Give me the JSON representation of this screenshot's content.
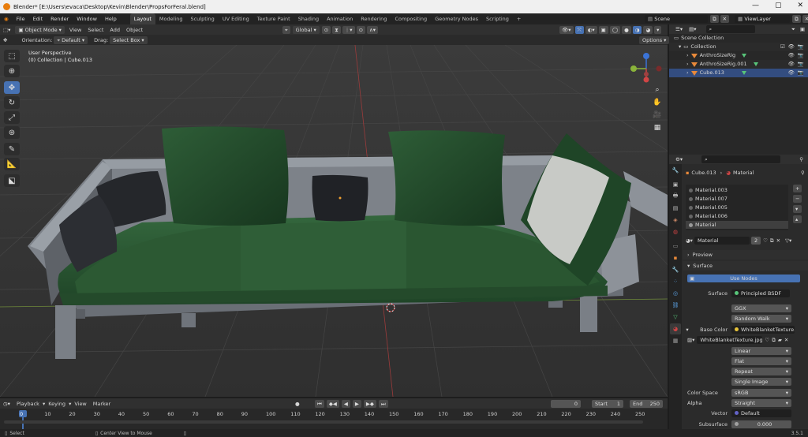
{
  "window": {
    "title": "Blender* [E:\\Users\\evaca\\Desktop\\Kevin\\Blender\\PropsForFeral.blend]",
    "buttons": [
      "—",
      "▢",
      "✕"
    ]
  },
  "menu": [
    "File",
    "Edit",
    "Render",
    "Window",
    "Help"
  ],
  "workspaces": [
    "Layout",
    "Modeling",
    "Sculpting",
    "UV Editing",
    "Texture Paint",
    "Shading",
    "Animation",
    "Rendering",
    "Compositing",
    "Geometry Nodes",
    "Scripting",
    "+"
  ],
  "active_workspace": "Layout",
  "scene": {
    "scene_name": "Scene",
    "view_layer": "ViewLayer"
  },
  "viewport_header": {
    "mode": "Object Mode",
    "view": "View",
    "select": "Select",
    "add": "Add",
    "object": "Object",
    "transform": "Global",
    "options": "Options"
  },
  "tool_settings": {
    "orientation_label": "Orientation:",
    "orientation": "Default",
    "drag_label": "Drag:",
    "drag": "Select Box"
  },
  "viewport": {
    "perspective": "User Perspective",
    "collection_info": "(0) Collection | Cube.013"
  },
  "outliner": {
    "search_placeholder": "",
    "items": [
      {
        "label": "Scene Collection",
        "indent": 0
      },
      {
        "label": "Collection",
        "indent": 1
      },
      {
        "label": "AnthroSizeRig",
        "indent": 2
      },
      {
        "label": "AnthroSizeRig.001",
        "indent": 2
      },
      {
        "label": "Cube.013",
        "indent": 2
      }
    ]
  },
  "properties": {
    "breadcrumb_object": "Cube.013",
    "breadcrumb_tab": "Material",
    "material_slots": [
      "Material.003",
      "Material.007",
      "Material.005",
      "Material.006",
      "Material"
    ],
    "active_material": "Material",
    "user_count": "2",
    "panels": {
      "preview": "Preview",
      "surface": "Surface"
    },
    "use_nodes": "Use Nodes",
    "surface_label": "Surface",
    "surface_value": "Principled BSDF",
    "distribution": "GGX",
    "subsurface_method": "Random Walk",
    "base_color_label": "Base Color",
    "base_color_value": "WhiteBlanketTexture.jpg",
    "image_name": "WhiteBlanketTexture.jpg",
    "interpolation": "Linear",
    "projection": "Flat",
    "extension": "Repeat",
    "source": "Single Image",
    "color_space_label": "Color Space",
    "color_space": "sRGB",
    "alpha_label": "Alpha",
    "alpha": "Straight",
    "vector_label": "Vector",
    "vector": "Default",
    "subsurface_label": "Subsurface",
    "subsurface": "0.000"
  },
  "timeline": {
    "menu": [
      "Playback",
      "Keying",
      "View",
      "Marker"
    ],
    "current_frame": "0",
    "start_label": "Start",
    "start": "1",
    "end_label": "End",
    "end": "250",
    "ticks": [
      "0",
      "10",
      "20",
      "30",
      "40",
      "50",
      "60",
      "70",
      "80",
      "90",
      "100",
      "110",
      "120",
      "130",
      "140",
      "150",
      "160",
      "170",
      "180",
      "190",
      "200",
      "210",
      "220",
      "230",
      "240",
      "250"
    ]
  },
  "statusbar": {
    "select": "Select",
    "center_view": "Center View to Mouse",
    "version": "3.5.1"
  },
  "colors": {
    "accent": "#4772b3",
    "object_orange": "#e8893a",
    "mesh_green": "#58c57a",
    "sofa_green": "#2f5a36"
  }
}
